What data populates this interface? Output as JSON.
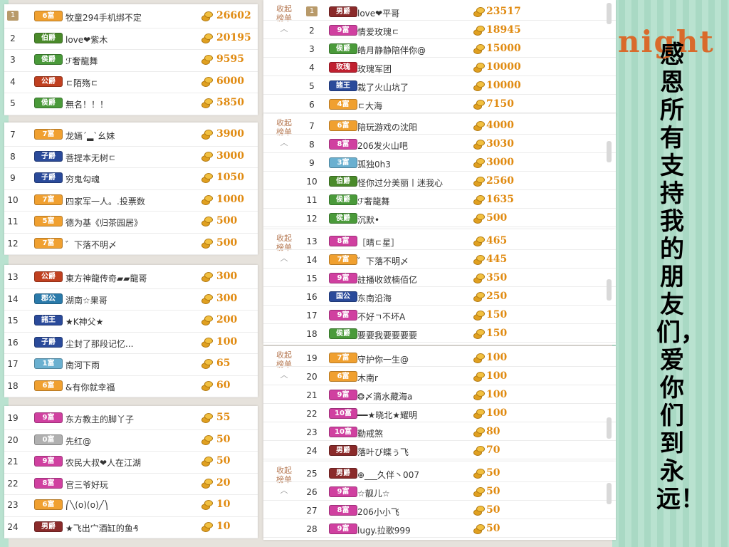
{
  "decor": {
    "word": "night"
  },
  "title_text": "感恩所有支持我的朋友们，爱你们到永远！",
  "collapse_label": "收起榜单",
  "left_rows": [
    {
      "rank": "1",
      "badge": "6富",
      "color": "#f0a030",
      "nick": "牧童294手机绑不定",
      "value": "26602",
      "first": true
    },
    {
      "rank": "2",
      "badge": "伯爵",
      "color": "#4a8a2a",
      "nick": "love❤紫木",
      "value": "20195"
    },
    {
      "rank": "3",
      "badge": "侯爵",
      "color": "#4a9a3a",
      "nick": "ℱ奢龍舞",
      "value": "9595"
    },
    {
      "rank": "4",
      "badge": "公爵",
      "color": "#c04020",
      "nick": "ㄷ陌殇ㄷ",
      "value": "6000"
    },
    {
      "rank": "5",
      "badge": "侯爵",
      "color": "#4a9a3a",
      "nick": "無名！！！",
      "value": "5850"
    },
    {
      "rank": "7",
      "badge": "7富",
      "color": "#f0a030",
      "nick": "龙婳ˊ▂ˋ幺妹",
      "value": "3900"
    },
    {
      "rank": "8",
      "badge": "子爵",
      "color": "#2a4a9a",
      "nick": "菩提本无树ㄷ",
      "value": "3000"
    },
    {
      "rank": "9",
      "badge": "子爵",
      "color": "#2a4a9a",
      "nick": "穷鬼勾魂",
      "value": "1050"
    },
    {
      "rank": "10",
      "badge": "7富",
      "color": "#f0a030",
      "nick": "四家军一人。.投票数",
      "value": "1000"
    },
    {
      "rank": "11",
      "badge": "5富",
      "color": "#f0a030",
      "nick": "德为基《归茶园居》",
      "value": "500"
    },
    {
      "rank": "12",
      "badge": "7富",
      "color": "#f0a030",
      "nick": "゛下落不明〆",
      "value": "500"
    },
    {
      "rank": "13",
      "badge": "公爵",
      "color": "#c04020",
      "nick": "東方神龍传奇▰▰龍哥",
      "value": "300"
    },
    {
      "rank": "14",
      "badge": "郡公",
      "color": "#2a7aaa",
      "nick": "湖南☆果哥",
      "value": "300"
    },
    {
      "rank": "15",
      "badge": "諸王",
      "color": "#2a4a9a",
      "nick": "★K神父★",
      "value": "200"
    },
    {
      "rank": "16",
      "badge": "子爵",
      "color": "#2a4a9a",
      "nick": "尘封了那段记忆...",
      "value": "100"
    },
    {
      "rank": "17",
      "badge": "1富",
      "color": "#6ab0d0",
      "nick": "南河下雨",
      "value": "65"
    },
    {
      "rank": "18",
      "badge": "6富",
      "color": "#f0a030",
      "nick": "&有你就幸福",
      "value": "60"
    },
    {
      "rank": "19",
      "badge": "9富",
      "color": "#d040a0",
      "nick": "东方教主的脚丫子",
      "value": "55"
    },
    {
      "rank": "20",
      "badge": "0富",
      "color": "#b0b0b0",
      "nick": "先红@",
      "value": "50"
    },
    {
      "rank": "21",
      "badge": "9富",
      "color": "#d040a0",
      "nick": "农民大叔❤人在江湖",
      "value": "50"
    },
    {
      "rank": "22",
      "badge": "8富",
      "color": "#d040a0",
      "nick": "官三爷好玩",
      "value": "20"
    },
    {
      "rank": "23",
      "badge": "6富",
      "color": "#f0a030",
      "nick": "⎛╲(o)(o)╱⎞",
      "value": "10"
    },
    {
      "rank": "24",
      "badge": "男爵",
      "color": "#8a2a2a",
      "nick": "★飞出宀酒缸的鱼₰",
      "value": "10"
    }
  ],
  "right_rows": [
    {
      "rank": "1",
      "badge": "男爵",
      "color": "#8a2a2a",
      "nick": "love❤平哥",
      "value": "23517",
      "first": true
    },
    {
      "rank": "2",
      "badge": "9富",
      "color": "#d040a0",
      "nick": "情爱玫瑰ㄷ",
      "value": "18945"
    },
    {
      "rank": "3",
      "badge": "侯爵",
      "color": "#4a9a3a",
      "nick": "皓月静静陪伴你@",
      "value": "15000"
    },
    {
      "rank": "4",
      "badge": "玫瑰",
      "color": "#c02030",
      "nick": "玫瑰军团",
      "value": "10000"
    },
    {
      "rank": "5",
      "badge": "諸王",
      "color": "#2a4a9a",
      "nick": "栽了火山坑了",
      "value": "10000"
    },
    {
      "rank": "6",
      "badge": "4富",
      "color": "#f0a030",
      "nick": "ㄷ大海",
      "value": "7150"
    },
    {
      "rank": "7",
      "badge": "6富",
      "color": "#f0a030",
      "nick": "陪玩游戏の沈阳",
      "value": "4000"
    },
    {
      "rank": "8",
      "badge": "8富",
      "color": "#d040a0",
      "nick": "206发火山吧",
      "value": "3030"
    },
    {
      "rank": "9",
      "badge": "3富",
      "color": "#6ab0d0",
      "nick": "孤独0h3",
      "value": "3000"
    },
    {
      "rank": "10",
      "badge": "伯爵",
      "color": "#4a8a2a",
      "nick": "怪你过分美丽丨迷我心",
      "value": "2560"
    },
    {
      "rank": "11",
      "badge": "侯爵",
      "color": "#4a9a3a",
      "nick": "ℱ奢龍舞",
      "value": "1635"
    },
    {
      "rank": "12",
      "badge": "侯爵",
      "color": "#4a9a3a",
      "nick": "沉默•",
      "value": "500"
    },
    {
      "rank": "13",
      "badge": "8富",
      "color": "#d040a0",
      "nick": "［晴ㄷ星］",
      "value": "465"
    },
    {
      "rank": "14",
      "badge": "7富",
      "color": "#f0a030",
      "nick": "゛下落不明〆",
      "value": "445"
    },
    {
      "rank": "15",
      "badge": "9富",
      "color": "#d040a0",
      "nick": "註播收敛楠佰亿",
      "value": "350"
    },
    {
      "rank": "16",
      "badge": "国公",
      "color": "#2a4a9a",
      "nick": "东南沿海",
      "value": "250"
    },
    {
      "rank": "17",
      "badge": "9富",
      "color": "#d040a0",
      "nick": "不好ㄱ不坏A",
      "value": "150"
    },
    {
      "rank": "18",
      "badge": "侯爵",
      "color": "#4a9a3a",
      "nick": "要要我要要要要",
      "value": "150"
    },
    {
      "rank": "19",
      "badge": "7富",
      "color": "#f0a030",
      "nick": "守护你一生@",
      "value": "100"
    },
    {
      "rank": "20",
      "badge": "6富",
      "color": "#f0a030",
      "nick": "木南r",
      "value": "100"
    },
    {
      "rank": "21",
      "badge": "9富",
      "color": "#d040a0",
      "nick": "❂〆滴水藏海a",
      "value": "100"
    },
    {
      "rank": "22",
      "badge": "10富",
      "color": "#d040a0",
      "nick": "━━★晓北★耀明",
      "value": "100"
    },
    {
      "rank": "23",
      "badge": "10富",
      "color": "#d040a0",
      "nick": "勤戒煞",
      "value": "80"
    },
    {
      "rank": "24",
      "badge": "男爵",
      "color": "#8a2a2a",
      "nick": "落叶び蝶ぅ飞",
      "value": "70"
    },
    {
      "rank": "25",
      "badge": "男爵",
      "color": "#8a2a2a",
      "nick": "⊕___久伴丶007",
      "value": "50"
    },
    {
      "rank": "26",
      "badge": "9富",
      "color": "#d040a0",
      "nick": "☆靓儿☆",
      "value": "50"
    },
    {
      "rank": "27",
      "badge": "8富",
      "color": "#d040a0",
      "nick": "206小小飞",
      "value": "50"
    },
    {
      "rank": "28",
      "badge": "9富",
      "color": "#d040a0",
      "nick": "lugy.拉歌999",
      "value": "50"
    }
  ]
}
